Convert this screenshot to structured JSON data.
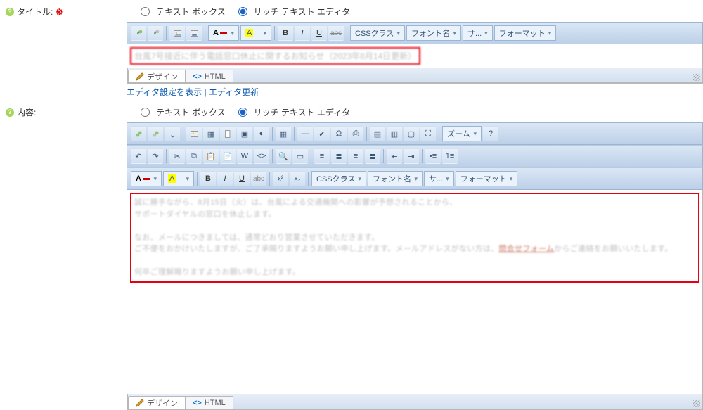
{
  "labels": {
    "title": "タイトル:",
    "required": "※",
    "content": "内容:"
  },
  "editorTypes": {
    "textbox": "テキスト ボックス",
    "rich": "リッチ テキスト エディタ"
  },
  "toolbar": {
    "cssClass": "CSSクラス",
    "fontName": "フォント名",
    "size": "サ...",
    "format": "フォーマット",
    "zoom": "ズーム",
    "fontColor": "A",
    "bgColor": "A"
  },
  "tabs": {
    "design": "デザイン",
    "html": "HTML"
  },
  "links": {
    "showSettings": "エディタ設定を表示",
    "sep": " | ",
    "refresh": "エディタ更新"
  },
  "titleContent": "台風7号接近に伴う電話窓口休止に関するお知らせ（2023年8月14日更新）",
  "bodyLines": [
    "誠に勝手ながら、8月15日（火）は、台風による交通機関への影響が予想されることから、",
    "サポートダイヤルの窓口を休止します。",
    "",
    "なお、メールにつきましては、通常どおり営業させていただきます。",
    "ご不便をおかけいたしますが、ご了承賜りますようお願い申し上げます。メールアドレスがない方は、<a href=\"/usefu/cns_inquiry\" target=\"_blank\">問合せフォーム</a>からご連絡をお願いいたします。",
    "",
    "何卒ご理解賜りますようお願い申し上げます。"
  ]
}
